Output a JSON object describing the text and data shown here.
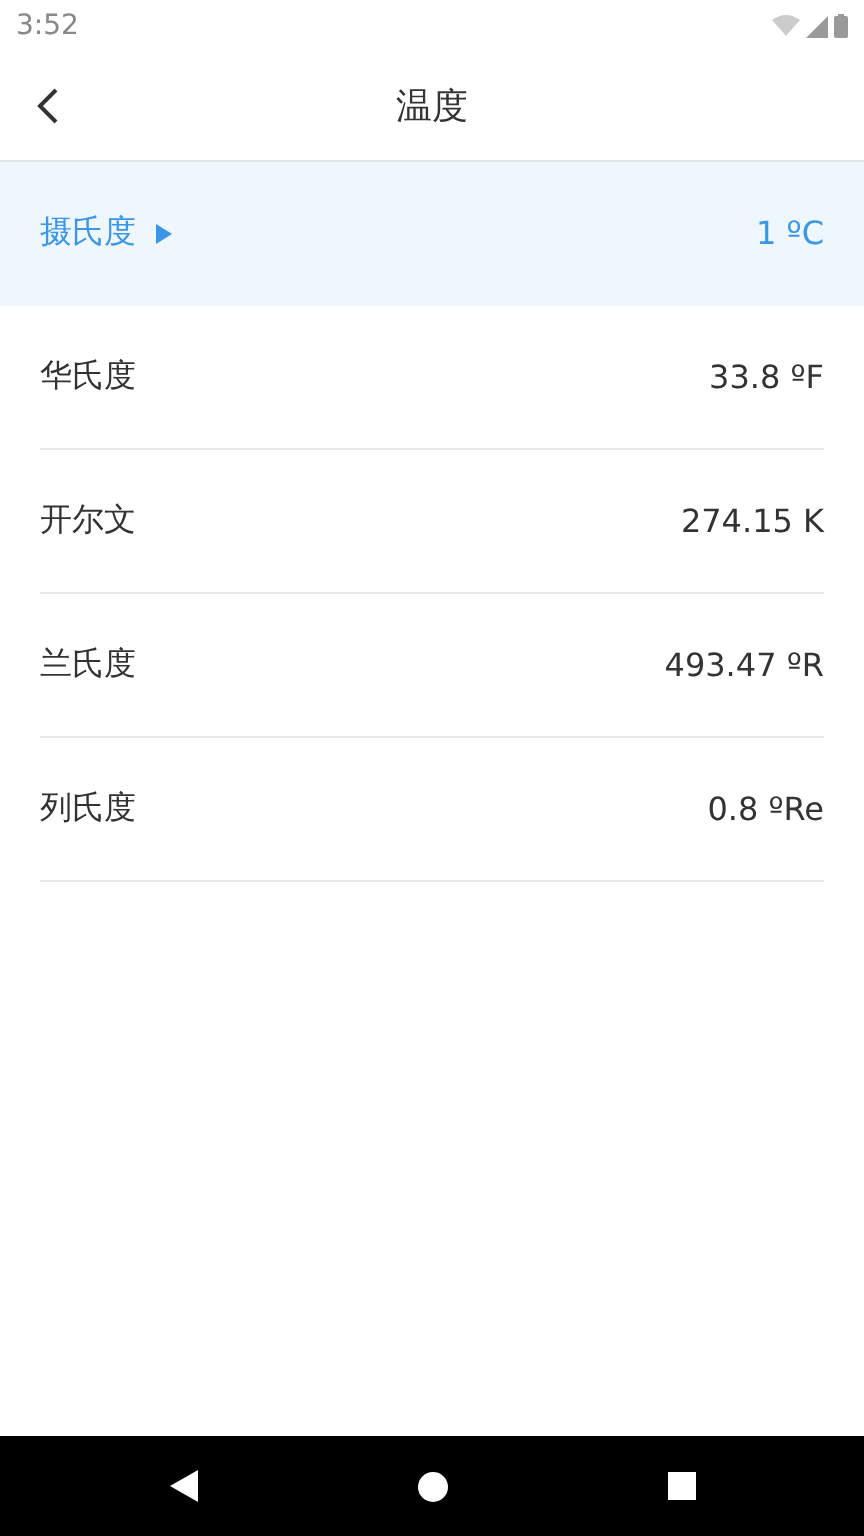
{
  "status_bar": {
    "time": "3:52"
  },
  "header": {
    "title": "温度"
  },
  "units": [
    {
      "name": "摄氏度",
      "value": "1 ºC",
      "selected": true
    },
    {
      "name": "华氏度",
      "value": "33.8 ºF",
      "selected": false
    },
    {
      "name": "开尔文",
      "value": "274.15 K",
      "selected": false
    },
    {
      "name": "兰氏度",
      "value": "493.47 ºR",
      "selected": false
    },
    {
      "name": "列氏度",
      "value": "0.8 ºRe",
      "selected": false
    }
  ]
}
